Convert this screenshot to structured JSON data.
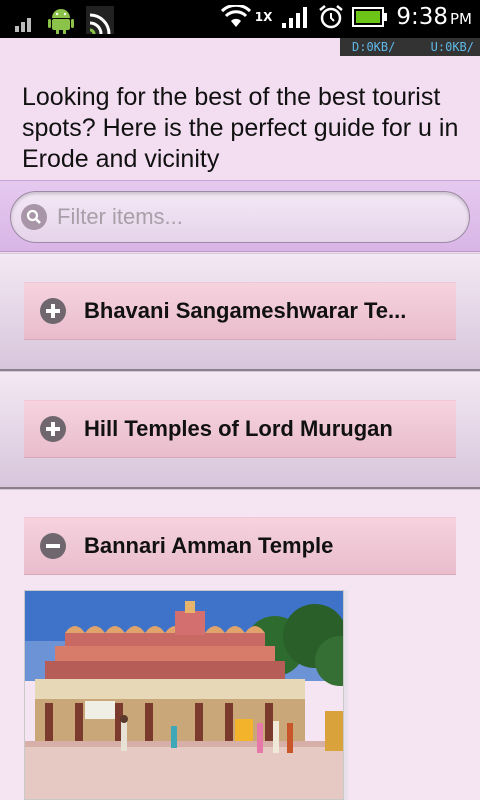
{
  "status_bar": {
    "time": "9:38",
    "ampm": "PM",
    "network_label": "1X",
    "download": "D:0KB/",
    "upload": "U:0KB/",
    "icons": [
      "signal-icon",
      "android-icon",
      "cast-icon",
      "wifi-icon",
      "cell-signal-icon",
      "alarm-icon",
      "battery-icon"
    ]
  },
  "header": {
    "intro": "Looking for the best of the best tourist spots? Here is the perfect guide for u in Erode and vicinity"
  },
  "filter": {
    "placeholder": "Filter items..."
  },
  "items": [
    {
      "title": "Bhavani Sangameshwarar Te...",
      "expanded": false
    },
    {
      "title": "Hill Temples of Lord Murugan",
      "expanded": false
    },
    {
      "title": "Bannari Amman Temple",
      "expanded": true
    }
  ],
  "colors": {
    "background": "#f3def1",
    "filter_bar": "#e0c0ec",
    "item_header": "#f0c6d4",
    "status_blue": "#5fb8e8"
  }
}
